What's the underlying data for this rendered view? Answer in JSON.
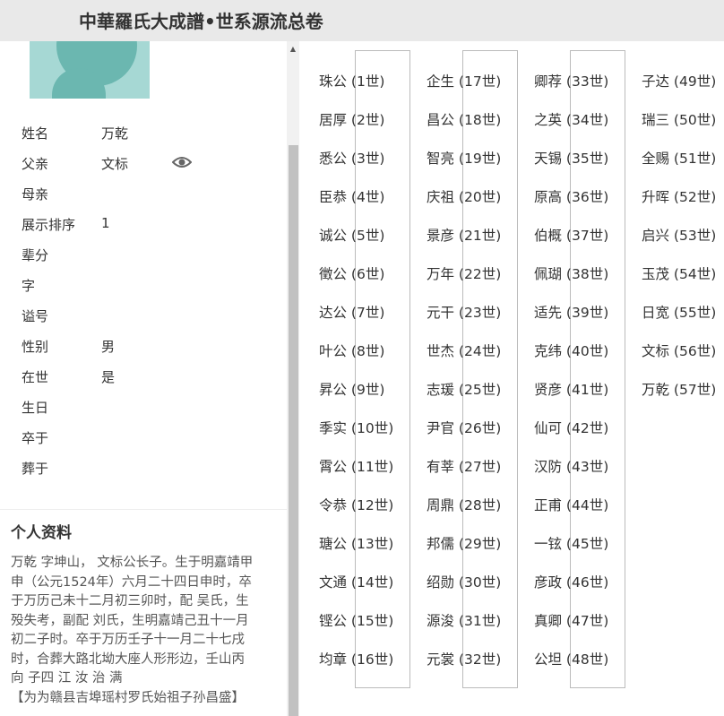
{
  "header": {
    "title": "中華羅氏大成譜•世系源流总卷"
  },
  "profile": {
    "fields": [
      {
        "label": "姓名",
        "value": "万乾"
      },
      {
        "label": "父亲",
        "value": "文标"
      },
      {
        "label": "母亲",
        "value": ""
      },
      {
        "label": "展示排序",
        "value": "1"
      },
      {
        "label": "辈分",
        "value": ""
      },
      {
        "label": "字",
        "value": ""
      },
      {
        "label": "谥号",
        "value": ""
      },
      {
        "label": "性别",
        "value": "男"
      },
      {
        "label": "在世",
        "value": "是"
      },
      {
        "label": "生日",
        "value": ""
      },
      {
        "label": "卒于",
        "value": ""
      },
      {
        "label": "葬于",
        "value": ""
      }
    ],
    "eye_icon": "eye-icon"
  },
  "bio": {
    "title": "个人资料",
    "lines": [
      "万乾 字坤山， 文标公长子。生于明嘉靖甲",
      "申（公元1524年）六月二十四日申时，卒",
      "于万历己未十二月初三卯时，配 吴氏，生",
      "殁失考，副配 刘氏，生明嘉靖己丑十一月",
      "初二子时。卒于万历壬子十一月二十七戌",
      "时，合葬大路北坳大座人形形边，壬山丙",
      "向 子四 江 汝 治 满"
    ],
    "note": "【为为赣县吉埠瑶村罗氏始祖子孙昌盛】"
  },
  "generations": [
    [
      "珠公 (1世)",
      "居厚 (2世)",
      "悉公 (3世)",
      "臣恭 (4世)",
      "诚公 (5世)",
      "徵公 (6世)",
      "达公 (7世)",
      "叶公 (8世)",
      "昇公 (9世)",
      "季实 (10世)",
      "霄公 (11世)",
      "令恭 (12世)",
      "瑭公 (13世)",
      "文通 (14世)",
      "铿公 (15世)",
      "均章 (16世)"
    ],
    [
      "企生 (17世)",
      "昌公 (18世)",
      "智亮 (19世)",
      "庆祖 (20世)",
      "景彦 (21世)",
      "万年 (22世)",
      "元干 (23世)",
      "世杰 (24世)",
      "志瑗 (25世)",
      "尹官 (26世)",
      "有莘 (27世)",
      "周鼎 (28世)",
      "邦儒 (29世)",
      "绍勋 (30世)",
      "源浚 (31世)",
      "元裳 (32世)"
    ],
    [
      "卿荐 (33世)",
      "之英 (34世)",
      "天锡 (35世)",
      "原高 (36世)",
      "伯概 (37世)",
      "佩瑚 (38世)",
      "适先 (39世)",
      "克纬 (40世)",
      "贤彦 (41世)",
      "仙可 (42世)",
      "汉防 (43世)",
      "正甫 (44世)",
      "一铉 (45世)",
      "彦政 (46世)",
      "真卿 (47世)",
      "公坦 (48世)"
    ],
    [
      "子达 (49世)",
      "瑞三 (50世)",
      "全赐 (51世)",
      "升晖 (52世)",
      "启兴 (53世)",
      "玉茂 (54世)",
      "日宽 (55世)",
      "文标 (56世)",
      "万乾 (57世)"
    ]
  ]
}
